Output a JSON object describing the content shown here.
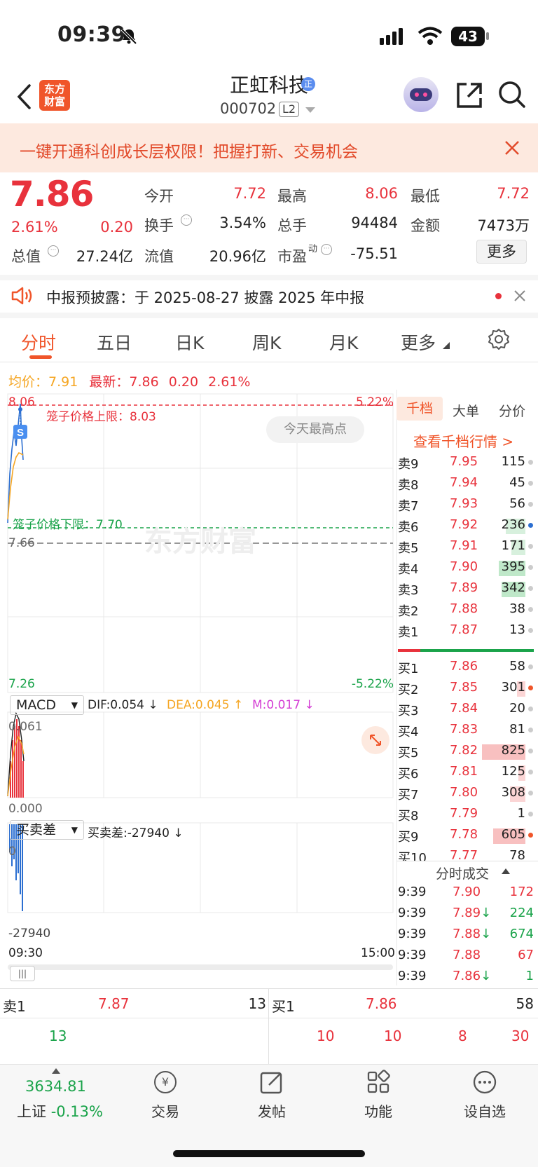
{
  "status": {
    "time": "09:39",
    "battery": "43"
  },
  "nav": {
    "title": "正虹科技",
    "code": "000702",
    "level": "L2",
    "logo_line1": "东方",
    "logo_line2": "财富",
    "badge": "正"
  },
  "promo": {
    "text": "一键开通科创成长层权限！把握打新、交易机会"
  },
  "quote": {
    "price": "7.86",
    "change_pct": "2.61%",
    "change": "0.20",
    "open_label": "今开",
    "open": "7.72",
    "high_label": "最高",
    "high": "8.06",
    "low_label": "最低",
    "low": "7.72",
    "turnover_label": "换手",
    "turnover": "3.54%",
    "volume_label": "总手",
    "volume": "94484",
    "amount_label": "金额",
    "amount": "7473万",
    "mktcap_label": "总值",
    "mktcap": "27.24亿",
    "float_label": "流值",
    "float": "20.96亿",
    "pe_label": "市盈",
    "pe_sup": "动",
    "pe": "-75.51",
    "more": "更多"
  },
  "notice": {
    "text": "中报预披露：于 2025-08-27 披露 2025 年中报"
  },
  "tabs": [
    "分时",
    "五日",
    "日K",
    "周K",
    "月K",
    "更多"
  ],
  "chart": {
    "avg_label": "均价：",
    "avg": "7.91",
    "latest_label": "最新：",
    "latest": "7.86",
    "latest_change": "0.20",
    "latest_pct": "2.61%",
    "y_top": "8.06",
    "y_top_pct": "5.22%",
    "y_mid": "7.66",
    "y_bottom": "7.26",
    "y_bottom_pct": "-5.22%",
    "upper_limit": "笼子价格上限：8.03",
    "lower_limit": "笼子价格下限：7.70",
    "today_high": "今天最高点",
    "watermark": "东方财富",
    "marker": "S",
    "macd_sel": "MACD",
    "dif": "DIF:0.054 ↓",
    "dea": "DEA:0.045 ↑",
    "m": "M:0.017 ↓",
    "macd_top": "0.061",
    "macd_bottom": "0.000",
    "bs_sel": "买卖差",
    "bs_value": "买卖差:-27940 ↓",
    "bs_top": "0",
    "bs_bottom": "-27940",
    "time_start": "09:30",
    "time_end": "15:00"
  },
  "order_book": {
    "tabs": [
      "千档",
      "大单",
      "分价"
    ],
    "title": "查看千档行情 >",
    "asks": [
      {
        "label": "卖9",
        "price": "7.95",
        "vol": "115"
      },
      {
        "label": "卖8",
        "price": "7.94",
        "vol": "45"
      },
      {
        "label": "卖7",
        "price": "7.93",
        "vol": "56"
      },
      {
        "label": "卖6",
        "price": "7.92",
        "vol": "236"
      },
      {
        "label": "卖5",
        "price": "7.91",
        "vol": "171"
      },
      {
        "label": "卖4",
        "price": "7.90",
        "vol": "395"
      },
      {
        "label": "卖3",
        "price": "7.89",
        "vol": "342"
      },
      {
        "label": "卖2",
        "price": "7.88",
        "vol": "38"
      },
      {
        "label": "卖1",
        "price": "7.87",
        "vol": "13"
      }
    ],
    "bids": [
      {
        "label": "买1",
        "price": "7.86",
        "vol": "58"
      },
      {
        "label": "买2",
        "price": "7.85",
        "vol": "301"
      },
      {
        "label": "买3",
        "price": "7.84",
        "vol": "20"
      },
      {
        "label": "买4",
        "price": "7.83",
        "vol": "81"
      },
      {
        "label": "买5",
        "price": "7.82",
        "vol": "825"
      },
      {
        "label": "买6",
        "price": "7.81",
        "vol": "125"
      },
      {
        "label": "买7",
        "price": "7.80",
        "vol": "308"
      },
      {
        "label": "买8",
        "price": "7.79",
        "vol": "1"
      },
      {
        "label": "买9",
        "price": "7.78",
        "vol": "605"
      },
      {
        "label": "买10",
        "price": "7.77",
        "vol": "78"
      }
    ],
    "trades_title": "分时成交",
    "trades": [
      {
        "time": "9:39",
        "price": "7.90",
        "arrow": "",
        "vol": "172",
        "color": "red"
      },
      {
        "time": "9:39",
        "price": "7.89",
        "arrow": "↓",
        "vol": "224",
        "color": "green"
      },
      {
        "time": "9:39",
        "price": "7.88",
        "arrow": "↓",
        "vol": "674",
        "color": "green"
      },
      {
        "time": "9:39",
        "price": "7.88",
        "arrow": "",
        "vol": "67",
        "color": "red"
      },
      {
        "time": "9:39",
        "price": "7.86",
        "arrow": "↓",
        "vol": "1",
        "color": "green"
      }
    ]
  },
  "bottom_quote": {
    "ask_label": "卖1",
    "ask_price": "7.87",
    "ask_vol": "13",
    "ask_detail": "13",
    "bid_label": "买1",
    "bid_price": "7.86",
    "bid_vol": "58",
    "bid_details": [
      "10",
      "10",
      "8",
      "30"
    ]
  },
  "bottom_nav": {
    "index_value": "3634.81",
    "index_name": "上证",
    "index_change": "-0.13%",
    "items": [
      "交易",
      "发帖",
      "功能",
      "设自选"
    ],
    "trade_glyph": "¥"
  },
  "colors": {
    "up": "#e8323c",
    "down": "#1aa34a",
    "accent": "#f0552a",
    "avg_line": "#f5a623"
  }
}
